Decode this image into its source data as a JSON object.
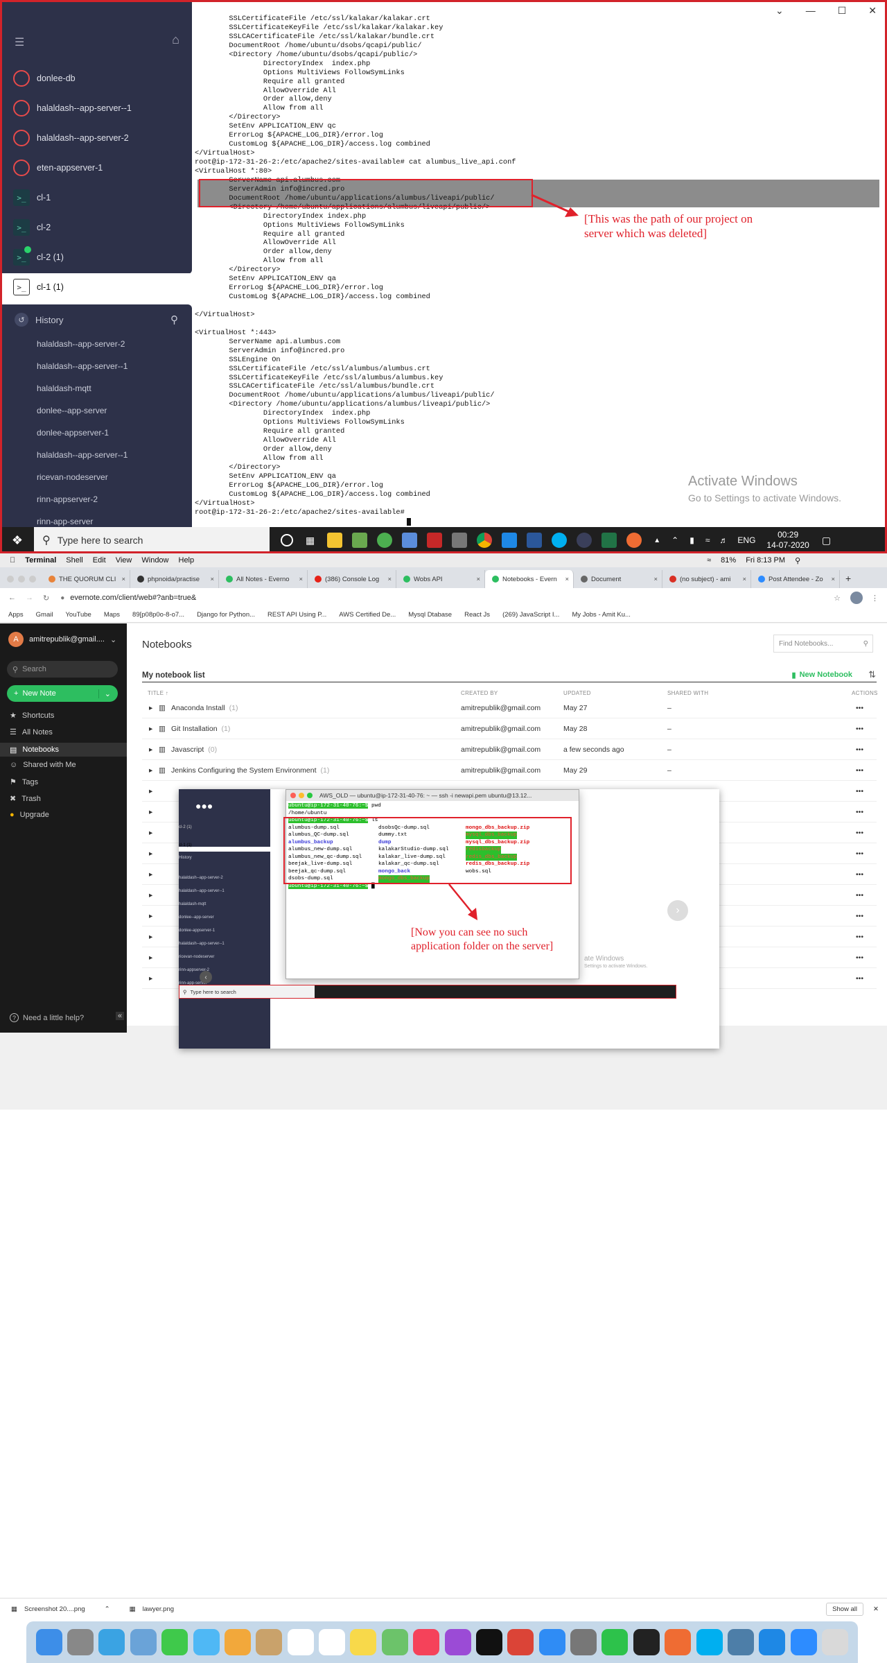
{
  "windows": {
    "sidebar": {
      "hosts": [
        {
          "label": "donlee-db",
          "type": "server"
        },
        {
          "label": "halaldash--app-server--1",
          "type": "server"
        },
        {
          "label": "halaldash--app-server-2",
          "type": "server"
        },
        {
          "label": "eten-appserver-1",
          "type": "server"
        },
        {
          "label": "cl-1",
          "type": "terminal"
        },
        {
          "label": "cl-2",
          "type": "terminal"
        },
        {
          "label": "cl-2 (1)",
          "type": "terminal"
        },
        {
          "label": "cl-1 (1)",
          "type": "terminal-active"
        }
      ],
      "history_label": "History",
      "history": [
        "halaldash--app-server-2",
        "halaldash--app-server--1",
        "halaldash-mqtt",
        "donlee--app-server",
        "donlee-appserver-1",
        "halaldash--app-server--1",
        "ricevan-nodeserver",
        "rinn-appserver-2",
        "rinn-app-server"
      ]
    },
    "terminal_lines": [
      "        SSLCertificateFile /etc/ssl/kalakar/kalakar.crt",
      "        SSLCertificateKeyFile /etc/ssl/kalakar/kalakar.key",
      "        SSLCACertificateFile /etc/ssl/kalakar/bundle.crt",
      "        DocumentRoot /home/ubuntu/dsobs/qcapi/public/",
      "        <Directory /home/ubuntu/dsobs/qcapi/public/>",
      "                DirectoryIndex  index.php",
      "                Options MultiViews FollowSymLinks",
      "                Require all granted",
      "                AllowOverride All",
      "                Order allow,deny",
      "                Allow from all",
      "        </Directory>",
      "        SetEnv APPLICATION_ENV qc",
      "        ErrorLog ${APACHE_LOG_DIR}/error.log",
      "        CustomLog ${APACHE_LOG_DIR}/access.log combined",
      "</VirtualHost>",
      "root@ip-172-31-26-2:/etc/apache2/sites-available# cat alumbus_live_api.conf",
      "<VirtualHost *:80>",
      "        ServerName api.alumbus.com",
      "        ServerAdmin info@incred.pro",
      "        DocumentRoot /home/ubuntu/applications/alumbus/liveapi/public/",
      "        <Directory /home/ubuntu/applications/alumbus/liveapi/public/>",
      "                DirectoryIndex index.php",
      "                Options MultiViews FollowSymLinks",
      "                Require all granted",
      "                AllowOverride All",
      "                Order allow,deny",
      "                Allow from all",
      "        </Directory>",
      "        SetEnv APPLICATION_ENV qa",
      "        ErrorLog ${APACHE_LOG_DIR}/error.log",
      "        CustomLog ${APACHE_LOG_DIR}/access.log combined",
      "",
      "</VirtualHost>",
      "",
      "<VirtualHost *:443>",
      "        ServerName api.alumbus.com",
      "        ServerAdmin info@incred.pro",
      "        SSLEngine On",
      "        SSLCertificateFile /etc/ssl/alumbus/alumbus.crt",
      "        SSLCertificateKeyFile /etc/ssl/alumbus/alumbus.key",
      "        SSLCACertificateFile /etc/ssl/alumbus/bundle.crt",
      "        DocumentRoot /home/ubuntu/applications/alumbus/liveapi/public/",
      "        <Directory /home/ubuntu/applications/alumbus/liveapi/public/>",
      "                DirectoryIndex  index.php",
      "                Options MultiViews FollowSymLinks",
      "                Require all granted",
      "                AllowOverride All",
      "                Order allow,deny",
      "                Allow from all",
      "        </Directory>",
      "        SetEnv APPLICATION_ENV qa",
      "        ErrorLog ${APACHE_LOG_DIR}/error.log",
      "        CustomLog ${APACHE_LOG_DIR}/access.log combined",
      "</VirtualHost>",
      "root@ip-172-31-26-2:/etc/apache2/sites-available# "
    ],
    "annotation_top": [
      "[This was the path of our project on",
      "server which was deleted]"
    ],
    "activate_title": "Activate Windows",
    "activate_sub": "Go to Settings to activate Windows.",
    "taskbar": {
      "search_placeholder": "Type here to search",
      "lang": "ENG",
      "time": "00:29",
      "date": "14-07-2020"
    }
  },
  "mac": {
    "menubar": {
      "app": "Terminal",
      "items": [
        "Shell",
        "Edit",
        "View",
        "Window",
        "Help"
      ],
      "battery": "81%",
      "clock": "Fri 8:13 PM"
    },
    "tabs": [
      "THE QUORUM CLI",
      "phpnoida/practise",
      "All Notes - Everno",
      "(386) Console Log",
      "Wobs API",
      "Notebooks - Evern",
      "Document",
      "(no subject) - ami",
      "Post Attendee - Zo"
    ],
    "active_tab_index": 5,
    "url": "evernote.com/client/web#?anb=true&",
    "bookmarks": [
      "Apps",
      "Gmail",
      "YouTube",
      "Maps",
      "89[p08p0o-8-o7...",
      "Django for Python...",
      "REST API Using P...",
      "AWS Certified De...",
      "Mysql Dtabase",
      "React Js",
      "(269) JavaScript I...",
      "My Jobs - Amit Ku..."
    ],
    "evernote": {
      "account": "amitrepublik@gmail....",
      "search_placeholder": "Search",
      "new_note": "New Note",
      "nav": [
        "Shortcuts",
        "All Notes",
        "Notebooks",
        "Shared with Me",
        "Tags",
        "Trash",
        "Upgrade"
      ],
      "help": "Need a little help?",
      "page_title": "Notebooks",
      "find_placeholder": "Find Notebooks...",
      "list_title": "My notebook list",
      "new_notebook": "New Notebook",
      "columns": [
        "TITLE ↑",
        "CREATED BY",
        "UPDATED",
        "SHARED WITH",
        "ACTIONS"
      ],
      "rows": [
        {
          "title": "Anaconda Install",
          "count": "(1)",
          "by": "amitrepublik@gmail.com",
          "updated": "May 27",
          "shared": "–"
        },
        {
          "title": "Git Installation",
          "count": "(1)",
          "by": "amitrepublik@gmail.com",
          "updated": "May 28",
          "shared": "–"
        },
        {
          "title": "Javascript",
          "count": "(0)",
          "by": "amitrepublik@gmail.com",
          "updated": "a few seconds ago",
          "shared": "–"
        },
        {
          "title": "Jenkins Configuring the System Environment",
          "count": "(1)",
          "by": "amitrepublik@gmail.com",
          "updated": "May 29",
          "shared": "–"
        }
      ]
    },
    "embedded_terminal": {
      "title": "AWS_OLD — ubuntu@ip-172-31-40-76: ~ — ssh -i newapi.pem ubuntu@13.12...",
      "prompt": "ubuntu@ip-172-31-40-76:~$",
      "cmd1": "pwd",
      "out1": "/home/ubuntu",
      "cmd2": "ls",
      "col1": [
        "alumbus-dump.sql",
        "alumbus_QC-dump.sql",
        "alumbus_backup",
        "alumbus_new-dump.sql",
        "alumbus_new_qc-dump.sql",
        "beejak_live-dump.sql",
        "beejak_qc-dump.sql",
        "dsobs-dump.sql"
      ],
      "col2": [
        "dsobsQc-dump.sql",
        "dummy.txt",
        "dump",
        "kalakarStudio-dump.sql",
        "kalakar_live-dump.sql",
        "kalakar_qc-dump.sql",
        "mongo_back",
        "mongo_dbs_backup"
      ],
      "col3": [
        "mongo_dbs_backup.zip",
        "mysql_dbs_backup",
        "mysql_dbs_backup.zip",
        "redisbackup",
        "redis_dbs_backup",
        "redis_dbs_backup.zip",
        "wobs.sql",
        ""
      ],
      "annotation": [
        "[Now you can see no such",
        "application folder on the server]"
      ],
      "mini_history": [
        "History",
        "halaldash--app-server-2",
        "halaldash--app-server--1",
        "halaldash-mqtt",
        "donlee--app-server",
        "donlee-appserver-1",
        "halaldash--app-server--1",
        "ricevan-nodeserver",
        "rinn-appserver-2",
        "rinn-app-server"
      ],
      "mini_search": "Type here to search",
      "mini_activate": "ate Windows",
      "mini_activate_sub": "Settings to activate Windows."
    },
    "downloads": [
      "Screenshot 20....png",
      "lawyer.png"
    ],
    "show_all": "Show all"
  },
  "colors": {
    "term_bg": "#2d3149",
    "accent_red": "#e0212b",
    "evernote_green": "#2dbe60",
    "ls_blue": "#3b3bd8",
    "ls_green_bg": "#2cbf2c",
    "ls_red": "#d11"
  }
}
